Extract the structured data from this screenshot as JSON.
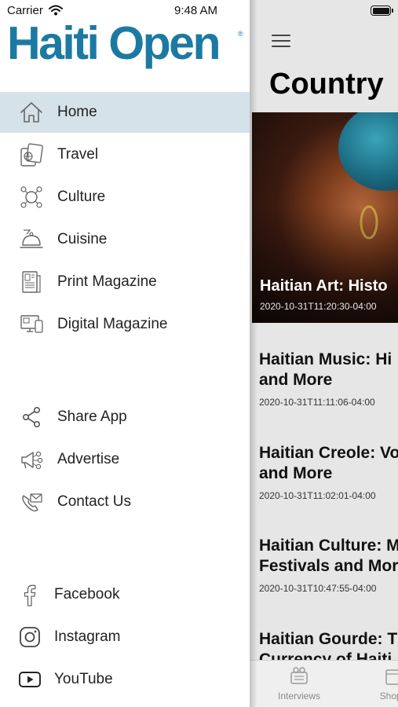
{
  "status": {
    "carrier": "Carrier",
    "time": "9:48 AM"
  },
  "drawer": {
    "logo": "Haiti Open",
    "logo_mark": "®",
    "menu": [
      {
        "label": "Home",
        "icon": "home-icon",
        "active": true
      },
      {
        "label": "Travel",
        "icon": "passport-icon"
      },
      {
        "label": "Culture",
        "icon": "culture-icon"
      },
      {
        "label": "Cuisine",
        "icon": "cloche-icon"
      },
      {
        "label": "Print Magazine",
        "icon": "newspaper-icon"
      },
      {
        "label": "Digital Magazine",
        "icon": "devices-icon"
      }
    ],
    "actions": [
      {
        "label": "Share App",
        "icon": "share-icon"
      },
      {
        "label": "Advertise",
        "icon": "megaphone-icon"
      },
      {
        "label": "Contact Us",
        "icon": "phone-mail-icon"
      }
    ],
    "social": [
      {
        "label": "Facebook",
        "icon": "facebook-icon"
      },
      {
        "label": "Instagram",
        "icon": "instagram-icon"
      },
      {
        "label": "YouTube",
        "icon": "youtube-icon"
      }
    ]
  },
  "content": {
    "page_title": "Country",
    "hero": {
      "title": "Haitian Art: Histo",
      "date": "2020-10-31T11:20:30-04:00"
    },
    "articles": [
      {
        "title_line1": "Haitian Music: Hi",
        "title_line2": "and More",
        "date": "2020-10-31T11:11:06-04:00"
      },
      {
        "title_line1": "Haitian Creole: Vo",
        "title_line2": "and More",
        "date": "2020-10-31T11:02:01-04:00"
      },
      {
        "title_line1": "Haitian Culture: M",
        "title_line2": "Festivals and Mor",
        "date": "2020-10-31T10:47:55-04:00"
      },
      {
        "title_line1": "Haitian Gourde: T",
        "title_line2": "Currency of Haiti"
      }
    ],
    "tabs": [
      {
        "label": "Interviews",
        "icon": "interviews-icon"
      },
      {
        "label": "Shop I",
        "icon": "shop-icon"
      }
    ]
  },
  "colors": {
    "brand": "#1c7aa2",
    "active_row": "#d6e2ea"
  }
}
